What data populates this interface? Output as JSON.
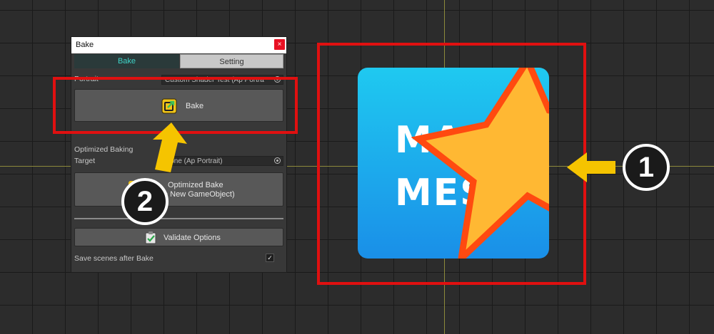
{
  "window": {
    "title": "Bake",
    "close_glyph": "×",
    "tabs": [
      {
        "label": "Bake",
        "active": true
      },
      {
        "label": "Setting",
        "active": false
      }
    ],
    "portrait_label": "Portrait",
    "portrait_value": "Custom Shader Test (Ap Portra",
    "bake_button": {
      "label": "Bake",
      "icon": "bake-icon"
    },
    "optimized_section_label": "Optimized Baking",
    "target_label": "Target",
    "target_value": "None (Ap Portrait)",
    "optimized_button": {
      "line1": "Optimized Bake",
      "line2": "(To the New GameObject)",
      "visible_line2": "e New GameObject)",
      "icon": "optimized-bake-icon"
    },
    "validate_button": {
      "label": "Validate Options",
      "icon": "clipboard-check-icon"
    },
    "save_scenes_label": "Save scenes after Bake",
    "save_scenes_checked": "✓"
  },
  "callouts": [
    {
      "number": "1"
    },
    {
      "number": "2"
    }
  ],
  "logo": {
    "line1": "MA",
    "line2": "MES",
    "icon": "star-icon"
  },
  "colors": {
    "highlight": "#e01010",
    "arrow": "#f5c400",
    "accent": "#3fd2c6"
  }
}
